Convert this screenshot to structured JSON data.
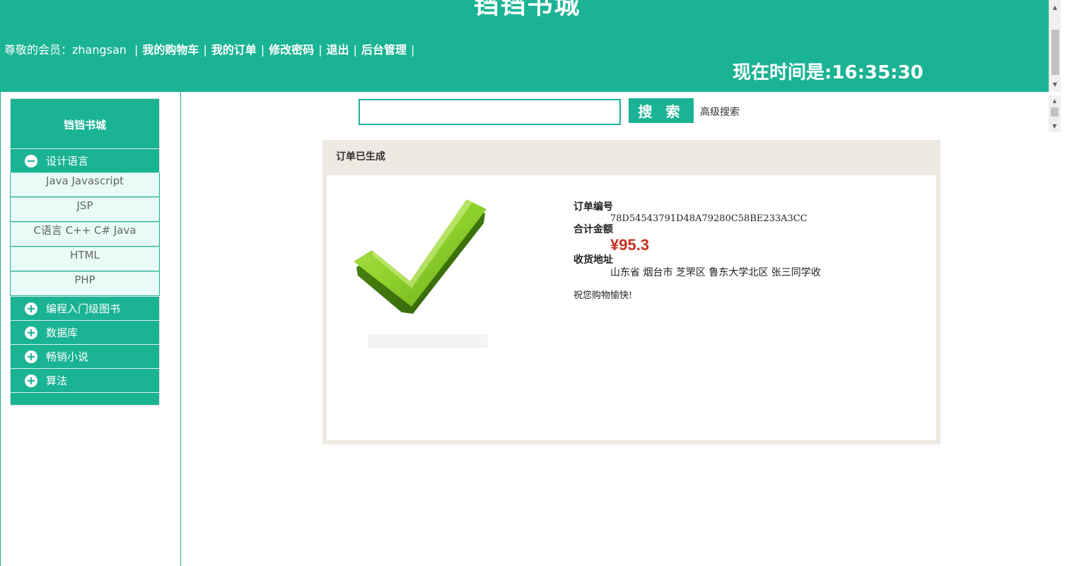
{
  "header": {
    "site_title": "铛铛书城",
    "member_prefix": "尊敬的会员：",
    "username": "zhangsan",
    "links": {
      "cart": "我的购物车",
      "orders": "我的订单",
      "password": "修改密码",
      "logout": "退出",
      "admin": "后台管理"
    },
    "separator": "|",
    "clock_prefix": "现在时间是:",
    "clock_time": "16:35:30"
  },
  "sidebar": {
    "title": "铛铛书城",
    "categories": [
      {
        "label": "设计语言",
        "icon": "minus-circle-icon",
        "expanded": true,
        "items": [
          "Java Javascript",
          "JSP",
          "C语言 C++ C# Java",
          "HTML",
          "PHP"
        ]
      },
      {
        "label": "编程入门级图书",
        "icon": "plus-circle-icon",
        "expanded": false
      },
      {
        "label": "数据库",
        "icon": "plus-circle-icon",
        "expanded": false
      },
      {
        "label": "畅销小说",
        "icon": "plus-circle-icon",
        "expanded": false
      },
      {
        "label": "算法",
        "icon": "plus-circle-icon",
        "expanded": false
      }
    ]
  },
  "search": {
    "value": "",
    "button_label": "搜 索",
    "advanced_label": "高级搜索"
  },
  "order": {
    "panel_title": "订单已生成",
    "number_label": "订单编号",
    "number_value": "78D54543791D48A79280C58BE233A3CC",
    "total_label": "合计金额",
    "total_value": "¥95.3",
    "address_label": "收货地址",
    "address_value": "山东省 烟台市 芝罘区 鲁东大学北区 张三同学收",
    "wish": "祝您购物愉快!",
    "icon": "checkmark-icon"
  },
  "colors": {
    "brand": "#1ab394",
    "price": "#c8301e",
    "panel_bg": "#efe9e4"
  }
}
